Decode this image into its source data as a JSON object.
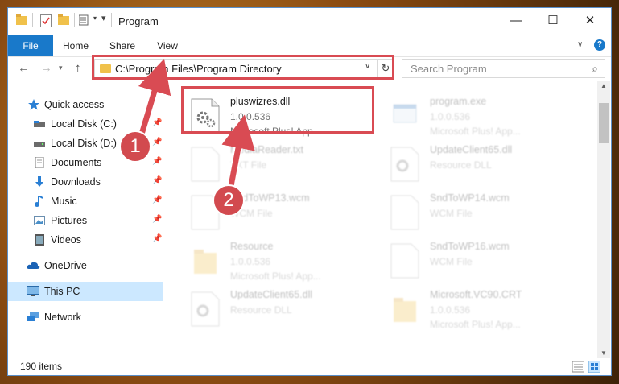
{
  "window": {
    "title": "Program",
    "controls": {
      "minimize": "—",
      "maximize": "☐",
      "close": "✕"
    }
  },
  "ribbon": {
    "tabs": [
      "File",
      "Home",
      "Share",
      "View"
    ]
  },
  "address": {
    "path": "C:\\Program Files\\Program Directory",
    "search_placeholder": "Search Program"
  },
  "nav_pane": {
    "items": [
      {
        "label": "Quick access",
        "icon": "star-icon",
        "pinned": false
      },
      {
        "label": "Local Disk (C:)",
        "icon": "drive-icon",
        "pinned": true
      },
      {
        "label": "Local Disk (D:)",
        "icon": "drive-icon",
        "pinned": true
      },
      {
        "label": "Documents",
        "icon": "documents-icon",
        "pinned": true
      },
      {
        "label": "Downloads",
        "icon": "download-icon",
        "pinned": true
      },
      {
        "label": "Music",
        "icon": "music-icon",
        "pinned": true
      },
      {
        "label": "Pictures",
        "icon": "pictures-icon",
        "pinned": true
      },
      {
        "label": "Videos",
        "icon": "videos-icon",
        "pinned": true
      },
      {
        "label": "OneDrive",
        "icon": "cloud-icon",
        "pinned": false
      },
      {
        "label": "This PC",
        "icon": "computer-icon",
        "pinned": false,
        "selected": true
      },
      {
        "label": "Network",
        "icon": "network-icon",
        "pinned": false
      }
    ]
  },
  "files": [
    {
      "name": "pluswizres.dll",
      "line2": "1.0.0.536",
      "line3": "Microsoft Plus! App...",
      "icon": "dll-gear-icon",
      "highlighted": true
    },
    {
      "name": "program.exe",
      "line2": "1.0.0.536",
      "line3": "Microsoft Plus! App...",
      "icon": "exe-icon"
    },
    {
      "name": "MediaReader.txt",
      "line2": "TXT File",
      "line3": "",
      "icon": "text-file-icon"
    },
    {
      "name": "UpdateClient65.dll",
      "line2": "Resource DLL",
      "line3": "",
      "icon": "dll-gear-icon"
    },
    {
      "name": "SndToWP13.wcm",
      "line2": "WCM File",
      "line3": "",
      "icon": "blank-file-icon"
    },
    {
      "name": "SndToWP14.wcm",
      "line2": "WCM File",
      "line3": "",
      "icon": "blank-file-icon"
    },
    {
      "name": "Resource",
      "line2": "1.0.0.536",
      "line3": "Microsoft Plus! App...",
      "icon": "folder-file-icon"
    },
    {
      "name": "SndToWP16.wcm",
      "line2": "WCM File",
      "line3": "",
      "icon": "blank-file-icon"
    },
    {
      "name": "UpdateClient65.dll",
      "line2": "Resource DLL",
      "line3": "",
      "icon": "dll-gear-icon"
    },
    {
      "name": "Microsoft.VC90.CRT",
      "line2": "1.0.0.536",
      "line3": "Microsoft Plus! App...",
      "icon": "folder-file-icon"
    }
  ],
  "status": {
    "item_count": "190 items"
  },
  "annotations": {
    "step1": "1",
    "step2": "2",
    "color": "#d94b53"
  }
}
